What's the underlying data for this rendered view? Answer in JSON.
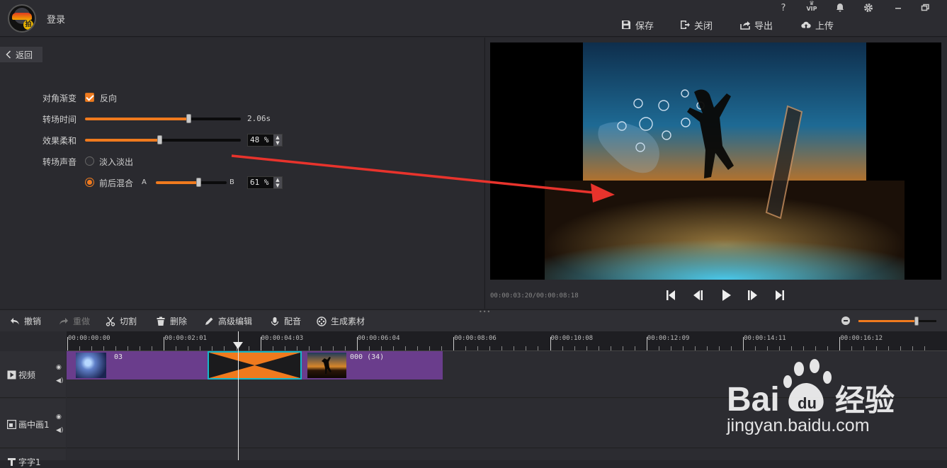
{
  "header": {
    "login_label": "登录",
    "window_icons": [
      "?",
      "VIP",
      "bell-icon",
      "gear-icon",
      "minimize-icon",
      "restore-icon"
    ],
    "vip_label": "VIP",
    "help_label": "?",
    "actions": [
      {
        "label": "保存",
        "icon": "save-icon"
      },
      {
        "label": "关闭",
        "icon": "exit-icon"
      },
      {
        "label": "导出",
        "icon": "export-icon"
      },
      {
        "label": "上传",
        "icon": "upload-icon"
      }
    ]
  },
  "settings": {
    "back_label": "返回",
    "diagonal_label": "对角渐变",
    "reverse_label": "反向",
    "reverse_checked": true,
    "duration_label": "转场时间",
    "duration_value": "2.06s",
    "duration_level": 0.67,
    "softness_label": "效果柔和",
    "softness_value": "48 %",
    "softness_level": 0.48,
    "sound_label": "转场声音",
    "fade_label": "淡入淡出",
    "fade_selected": false,
    "mix_label": "前后混合",
    "mix_selected": true,
    "mix_a": "A",
    "mix_b": "B",
    "mix_value": "61 %",
    "mix_level": 0.61
  },
  "preview": {
    "timecode": "00:00:03:20/00:00:08:18"
  },
  "toolbar": {
    "undo": "撤销",
    "redo": "重做",
    "cut": "切割",
    "delete": "删除",
    "advanced": "高级编辑",
    "dub": "配音",
    "generate": "生成素材",
    "zoom_level": 0.75
  },
  "timeline": {
    "ruler_labels": [
      "00:00:00:00",
      "00:00:02:01",
      "00:00:04:03",
      "00:00:06:04",
      "00:00:08:06",
      "00:00:10:08",
      "00:00:12:09",
      "00:00:14:11",
      "00:00:16:12"
    ],
    "tracks": [
      {
        "name": "视频",
        "icon": "play-box-icon"
      },
      {
        "name": "画中画1",
        "icon": "pip-icon"
      },
      {
        "name": "字字1",
        "icon": "text-icon"
      }
    ],
    "clips": [
      {
        "name": "03"
      },
      {
        "name": "000 (34)"
      }
    ]
  },
  "watermark": {
    "brand": "Baidu经验",
    "url": "jingyan.baidu.com"
  },
  "colors": {
    "accent": "#f07a1e",
    "clip_purple": "#6a3d8c",
    "transition_border": "#16b7c8",
    "arrow_red": "#e8332c"
  }
}
